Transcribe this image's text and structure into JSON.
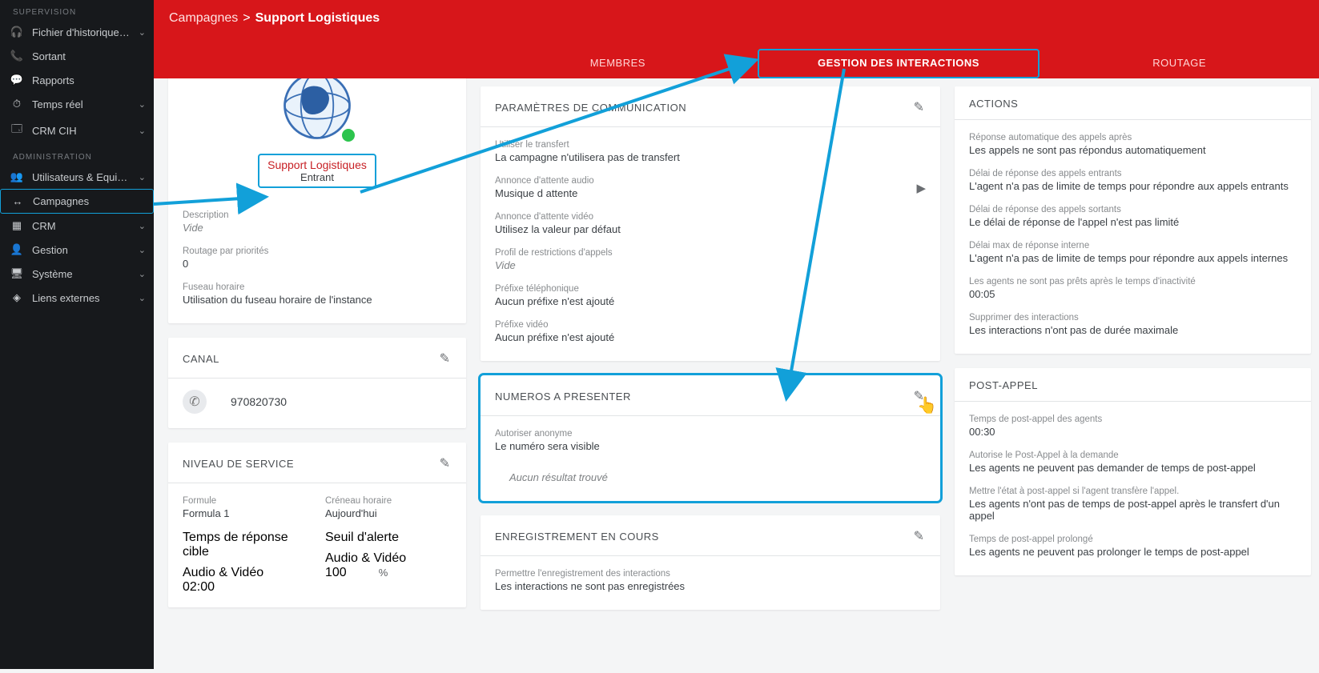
{
  "sidebar": {
    "section1": "SUPERVISION",
    "items1": [
      {
        "label": "Fichier d'historique des in…",
        "icon": "🎧",
        "expand": true
      },
      {
        "label": "Sortant",
        "icon": "📞",
        "expand": false
      },
      {
        "label": "Rapports",
        "icon": "💬",
        "expand": false
      },
      {
        "label": "Temps réel",
        "icon": "⏱",
        "expand": true
      },
      {
        "label": "CRM CIH",
        "icon": "🗔",
        "expand": true
      }
    ],
    "section2": "ADMINISTRATION",
    "items2": [
      {
        "label": "Utilisateurs & Equipes",
        "icon": "👥",
        "expand": true
      },
      {
        "label": "Campagnes",
        "icon": "↔",
        "expand": false,
        "boxed": true
      },
      {
        "label": "CRM",
        "icon": "▦",
        "expand": true
      },
      {
        "label": "Gestion",
        "icon": "👤",
        "expand": true
      },
      {
        "label": "Système",
        "icon": "🖥",
        "expand": true
      },
      {
        "label": "Liens externes",
        "icon": "◈",
        "expand": true
      }
    ]
  },
  "breadcrumb": {
    "first": "Campagnes",
    "sep": ">",
    "second": "Support Logistiques"
  },
  "tabs": {
    "t1": "MEMBRES",
    "t2": "GESTION DES INTERACTIONS",
    "t3": "ROUTAGE"
  },
  "summary": {
    "name": "Support Logistiques",
    "direction": "Entrant",
    "desc_label": "Description",
    "desc_value": "Vide",
    "prio_label": "Routage par priorités",
    "prio_value": "0",
    "tz_label": "Fuseau horaire",
    "tz_value": "Utilisation du fuseau horaire de l'instance"
  },
  "channel": {
    "title": "CANAL",
    "number": "970820730"
  },
  "service": {
    "title": "NIVEAU DE SERVICE",
    "formula_label": "Formule",
    "formula_value": "Formula 1",
    "slot_label": "Créneau horaire",
    "slot_value": "Aujourd'hui",
    "target_label": "Temps de réponse cible",
    "target_sub": "Audio & Vidéo",
    "target_value": "02:00",
    "alert_label": "Seuil d'alerte",
    "alert_sub": "Audio & Vidéo",
    "alert_value": "100",
    "pct": "%"
  },
  "comm": {
    "title": "PARAMÈTRES DE COMMUNICATION",
    "f1_l": "Utiliser le transfert",
    "f1_v": "La campagne n'utilisera pas de transfert",
    "f2_l": "Annonce d'attente audio",
    "f2_v": "Musique d attente",
    "f3_l": "Annonce d'attente vidéo",
    "f3_v": "Utilisez la valeur par défaut",
    "f4_l": "Profil de restrictions d'appels",
    "f4_v": "Vide",
    "f5_l": "Préfixe téléphonique",
    "f5_v": "Aucun préfixe n'est ajouté",
    "f6_l": "Préfixe vidéo",
    "f6_v": "Aucun préfixe n'est ajouté"
  },
  "numbers": {
    "title": "NUMEROS A PRESENTER",
    "anon_l": "Autoriser anonyme",
    "anon_v": "Le numéro sera visible",
    "empty": "Aucun résultat trouvé"
  },
  "record": {
    "title": "ENREGISTREMENT EN COURS",
    "f1_l": "Permettre l'enregistrement des interactions",
    "f1_v": "Les interactions ne sont pas enregistrées"
  },
  "actions": {
    "title": "ACTIONS",
    "a1_l": "Réponse automatique des appels après",
    "a1_v": "Les appels ne sont pas répondus automatiquement",
    "a2_l": "Délai de réponse des appels entrants",
    "a2_v": "L'agent n'a pas de limite de temps pour répondre aux appels entrants",
    "a3_l": "Délai de réponse des appels sortants",
    "a3_v": "Le délai de réponse de l'appel n'est pas limité",
    "a4_l": "Délai max de réponse interne",
    "a4_v": "L'agent n'a pas de limite de temps pour répondre aux appels internes",
    "a5_l": "Les agents ne sont pas prêts après le temps d'inactivité",
    "a5_v": "00:05",
    "a6_l": "Supprimer des interactions",
    "a6_v": "Les interactions n'ont pas de durée maximale"
  },
  "post": {
    "title": "POST-APPEL",
    "p1_l": "Temps de post-appel des agents",
    "p1_v": "00:30",
    "p2_l": "Autorise le Post-Appel à la demande",
    "p2_v": "Les agents ne peuvent pas demander de temps de post-appel",
    "p3_l": "Mettre l'état à post-appel si l'agent transfère l'appel.",
    "p3_v": "Les agents n'ont pas de temps de post-appel après le transfert d'un appel",
    "p4_l": "Temps de post-appel prolongé",
    "p4_v": "Les agents ne peuvent pas prolonger le temps de post-appel"
  }
}
